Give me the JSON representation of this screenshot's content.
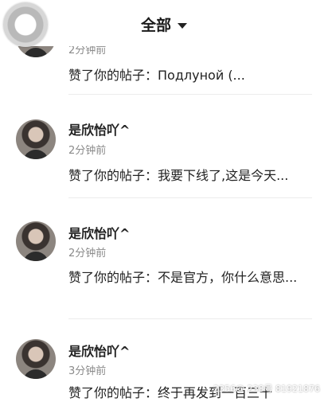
{
  "header": {
    "title": "全部"
  },
  "feed": {
    "items": [
      {
        "name": "",
        "time": "2分钟前",
        "message": "赞了你的帖子：Подлуной (..."
      },
      {
        "name": "是欣怡吖^",
        "time": "2分钟前",
        "message": "赞了你的帖子：我要下线了,这是今天..."
      },
      {
        "name": "是欣怡吖^",
        "time": "2分钟前",
        "message": "赞了你的帖子：不是官方，你什么意思..."
      },
      {
        "name": "是欣怡吖^",
        "time": "3分钟前",
        "message": "赞了你的帖子：终于再发到一百三十"
      }
    ]
  },
  "watermark": "2356@ 238号 81921876"
}
